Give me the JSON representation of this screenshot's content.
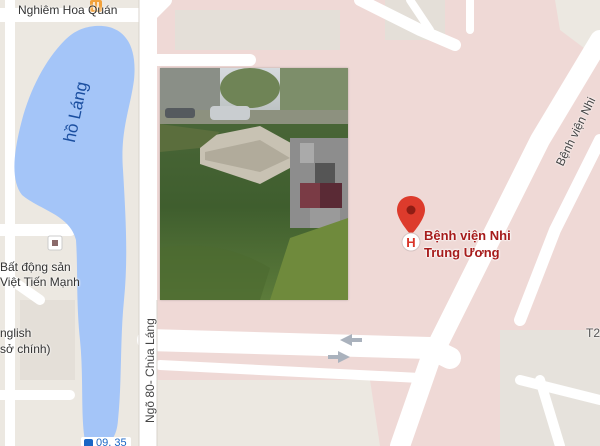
{
  "map": {
    "lake_label": "hồ Láng",
    "places": {
      "restaurant": "Nghiêm Hoa Quán",
      "real_estate_line1": "Bất động sản",
      "real_estate_line2": "Việt Tiến Mạnh",
      "hospital_line1": "Bệnh viện Nhi",
      "hospital_line2": "Trung Ương",
      "english_partial": "nglish",
      "english_partial_2": "sở chính)",
      "t2_partial": "T2"
    },
    "roads": {
      "alley_80": "Ngõ 80- Chùa Láng",
      "benh_vien_nhi_road": "Bệnh viện Nhi"
    },
    "bus_stop": {
      "label": "09, 35"
    },
    "colors": {
      "lake": "#a4c5f8",
      "hospital_area": "#efd9d6",
      "road": "#ffffff",
      "land": "#ece8e1",
      "marker": "#dd3b2c",
      "poi_text": "#a61b1b"
    }
  }
}
